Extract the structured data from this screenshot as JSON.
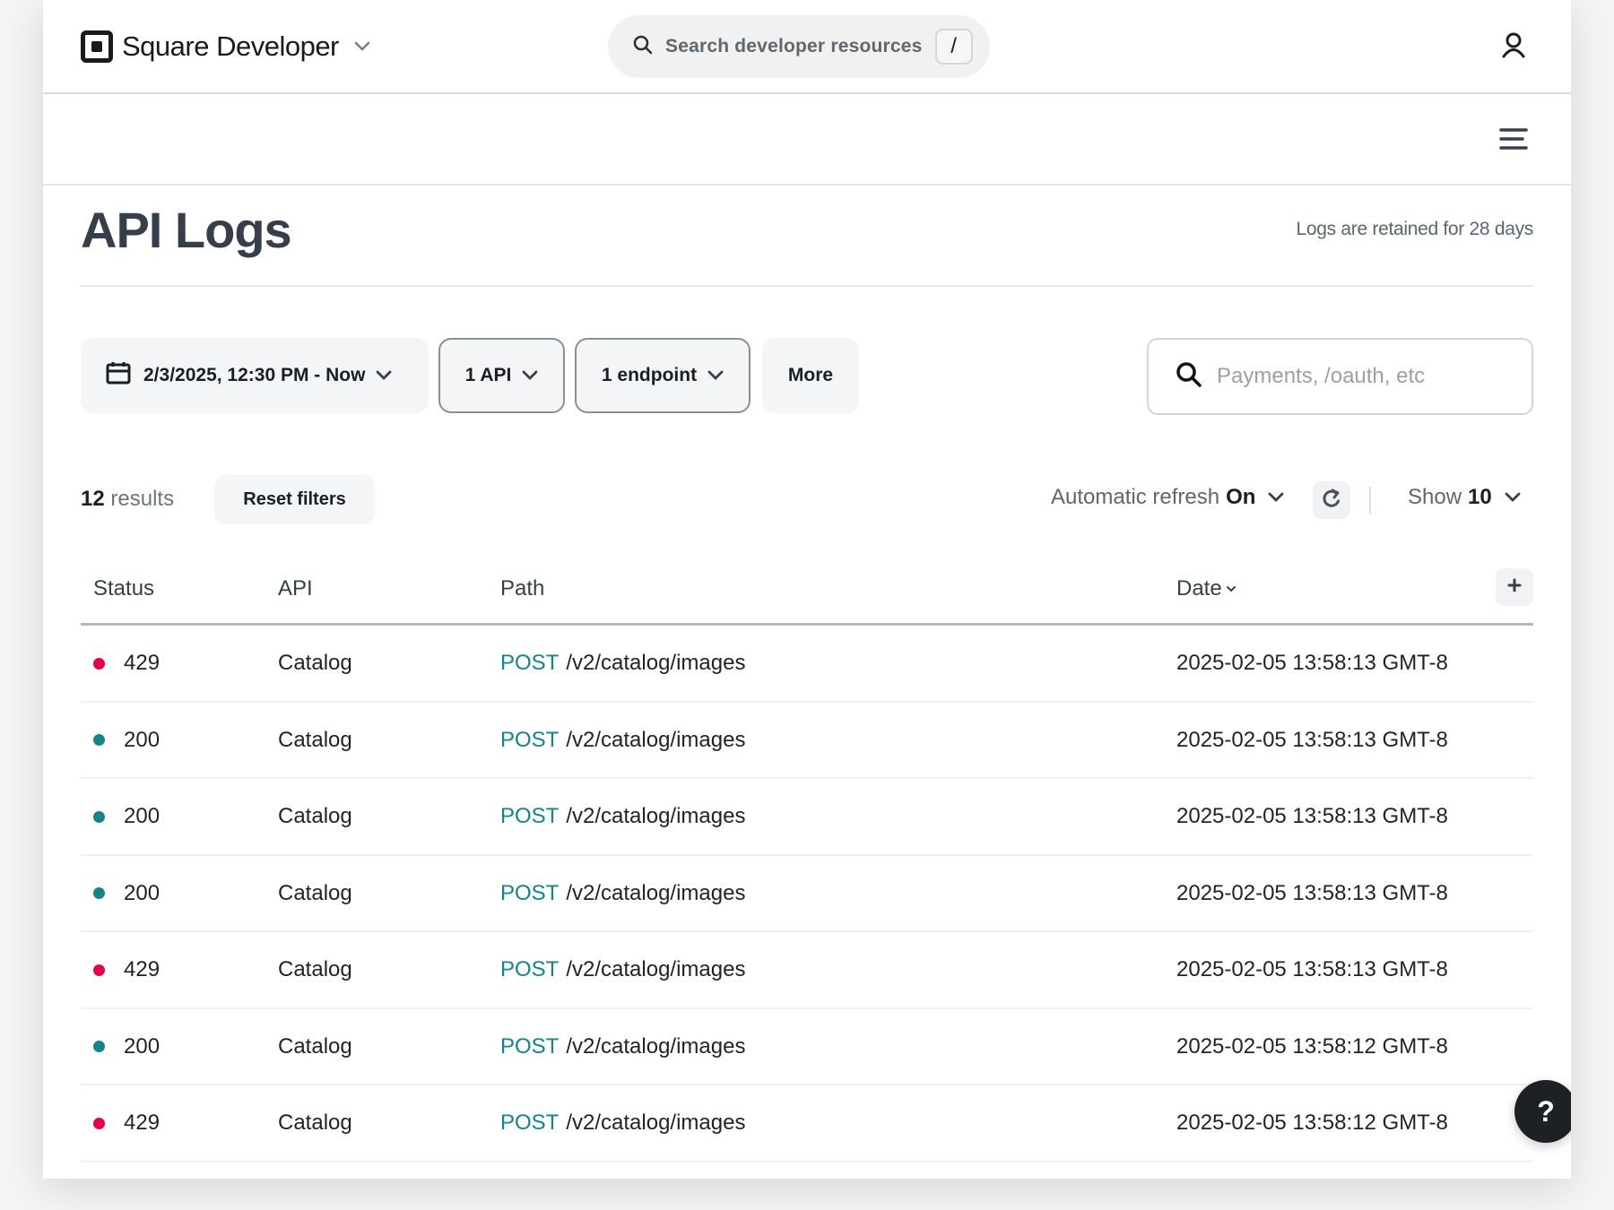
{
  "header": {
    "brand": "Square Developer",
    "search_label": "Search developer resources",
    "search_shortcut": "/"
  },
  "page": {
    "title": "API Logs",
    "retention_note": "Logs are retained for 28 days"
  },
  "filters": {
    "date_range": "2/3/2025, 12:30 PM - Now",
    "api": "1 API",
    "endpoint": "1 endpoint",
    "more": "More",
    "path_search_placeholder": "Payments, /oauth, etc",
    "path_search_value": ""
  },
  "results": {
    "count": "12",
    "count_suffix": "results",
    "reset_label": "Reset filters",
    "auto_refresh_label": "Automatic refresh",
    "auto_refresh_value": "On",
    "show_label": "Show",
    "show_value": "10"
  },
  "table": {
    "columns": [
      "Status",
      "API",
      "Path",
      "Date"
    ],
    "rows": [
      {
        "status": "429",
        "api": "Catalog",
        "method": "POST",
        "path": "/v2/catalog/images",
        "date": "2025-02-05 13:58:13 GMT-8"
      },
      {
        "status": "200",
        "api": "Catalog",
        "method": "POST",
        "path": "/v2/catalog/images",
        "date": "2025-02-05 13:58:13 GMT-8"
      },
      {
        "status": "200",
        "api": "Catalog",
        "method": "POST",
        "path": "/v2/catalog/images",
        "date": "2025-02-05 13:58:13 GMT-8"
      },
      {
        "status": "200",
        "api": "Catalog",
        "method": "POST",
        "path": "/v2/catalog/images",
        "date": "2025-02-05 13:58:13 GMT-8"
      },
      {
        "status": "429",
        "api": "Catalog",
        "method": "POST",
        "path": "/v2/catalog/images",
        "date": "2025-02-05 13:58:13 GMT-8"
      },
      {
        "status": "200",
        "api": "Catalog",
        "method": "POST",
        "path": "/v2/catalog/images",
        "date": "2025-02-05 13:58:12 GMT-8"
      },
      {
        "status": "429",
        "api": "Catalog",
        "method": "POST",
        "path": "/v2/catalog/images",
        "date": "2025-02-05 13:58:12 GMT-8"
      }
    ]
  },
  "help_label": "?",
  "colors": {
    "status_error": "#e3004f",
    "status_success": "#14848a",
    "method": "#14848a"
  }
}
